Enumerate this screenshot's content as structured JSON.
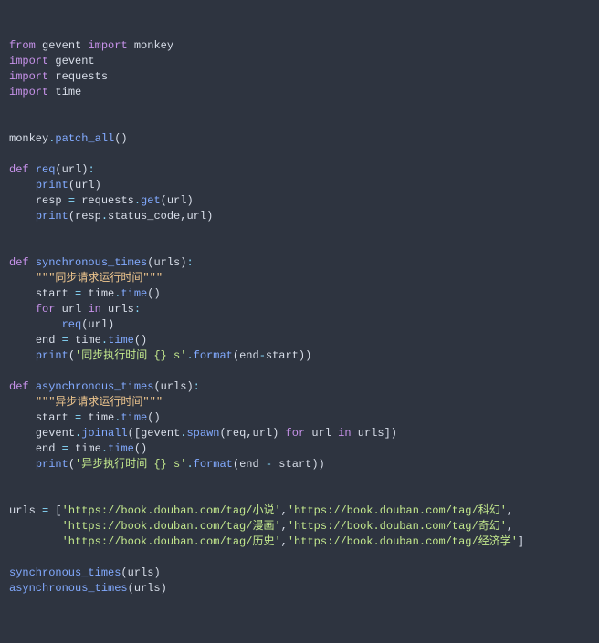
{
  "code": {
    "l1": {
      "from": "from",
      "mod1": "gevent",
      "imp": "import",
      "mod2": "monkey"
    },
    "l2": {
      "imp": "import",
      "mod": "gevent"
    },
    "l3": {
      "imp": "import",
      "mod": "requests"
    },
    "l4": {
      "imp": "import",
      "mod": "time"
    },
    "l7": {
      "obj": "monkey",
      "dot": ".",
      "fn": "patch_all",
      "call": "()"
    },
    "l9": {
      "def": "def",
      "name": "req",
      "paren_o": "(",
      "arg": "url",
      "paren_c": ")",
      "colon": ":"
    },
    "l10": {
      "print": "print",
      "paren_o": "(",
      "arg": "url",
      "paren_c": ")"
    },
    "l11": {
      "v": "resp",
      "eq": " = ",
      "obj": "requests",
      "dot": ".",
      "fn": "get",
      "paren_o": "(",
      "arg": "url",
      "paren_c": ")"
    },
    "l12": {
      "print": "print",
      "paren_o": "(",
      "a1": "resp",
      "dot": ".",
      "a2": "status_code",
      "comma": ",",
      "a3": "url",
      "paren_c": ")"
    },
    "l15": {
      "def": "def",
      "name": "synchronous_times",
      "paren_o": "(",
      "arg": "urls",
      "paren_c": ")",
      "colon": ":"
    },
    "l16": {
      "doc": "\"\"\"同步请求运行时间\"\"\""
    },
    "l17": {
      "v": "start",
      "eq": " = ",
      "obj": "time",
      "dot": ".",
      "fn": "time",
      "call": "()"
    },
    "l18": {
      "for": "for",
      "v": "url",
      "in": "in",
      "it": "urls",
      "colon": ":"
    },
    "l19": {
      "fn": "req",
      "paren_o": "(",
      "arg": "url",
      "paren_c": ")"
    },
    "l20": {
      "v": "end",
      "eq": " = ",
      "obj": "time",
      "dot": ".",
      "fn": "time",
      "call": "()"
    },
    "l21": {
      "print": "print",
      "paren_o": "(",
      "str": "'同步执行时间 {} s'",
      "dot": ".",
      "fmt": "format",
      "p2o": "(",
      "a": "end",
      "minus": "-",
      "b": "start",
      "p2c": ")",
      "paren_c": ")"
    },
    "l23": {
      "def": "def",
      "name": "asynchronous_times",
      "paren_o": "(",
      "arg": "urls",
      "paren_c": ")",
      "colon": ":"
    },
    "l24": {
      "doc": "\"\"\"异步请求运行时间\"\"\""
    },
    "l25": {
      "v": "start",
      "eq": " = ",
      "obj": "time",
      "dot": ".",
      "fn": "time",
      "call": "()"
    },
    "l26": {
      "obj": "gevent",
      "dot": ".",
      "fn": "joinall",
      "po": "(",
      "bo": "[",
      "o2": "gevent",
      "dot2": ".",
      "fn2": "spawn",
      "p2o": "(",
      "a1": "req",
      "c1": ",",
      "a2": "url",
      "p2c": ")",
      "for": " for ",
      "v": "url",
      "in": " in ",
      "it": "urls",
      "bc": "]",
      "pc": ")"
    },
    "l27": {
      "v": "end",
      "eq": " = ",
      "obj": "time",
      "dot": ".",
      "fn": "time",
      "call": "()"
    },
    "l28": {
      "print": "print",
      "paren_o": "(",
      "str": "'异步执行时间 {} s'",
      "dot": ".",
      "fmt": "format",
      "p2o": "(",
      "a": "end",
      "minus": " - ",
      "b": "start",
      "p2c": ")",
      "paren_c": ")"
    },
    "l31a": {
      "v": "urls",
      "eq": " = ",
      "bo": "[",
      "s1": "'https://book.douban.com/tag/小说'",
      "c1": ",",
      "s2": "'https://book.douban.com/tag/科幻'",
      "c2": ","
    },
    "l31b": {
      "s3": "'https://book.douban.com/tag/漫画'",
      "c3": ",",
      "s4": "'https://book.douban.com/tag/奇幻'",
      "c4": ","
    },
    "l31c": {
      "s5": "'https://book.douban.com/tag/历史'",
      "c5": ",",
      "s6": "'https://book.douban.com/tag/经济学'",
      "bc": "]"
    },
    "l33": {
      "fn": "synchronous_times",
      "po": "(",
      "arg": "urls",
      "pc": ")"
    },
    "l34": {
      "fn": "asynchronous_times",
      "po": "(",
      "arg": "urls",
      "pc": ")"
    }
  }
}
